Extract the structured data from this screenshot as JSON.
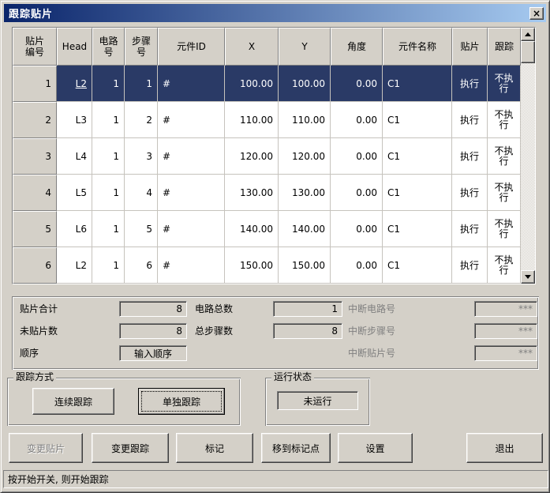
{
  "window": {
    "title": "跟踪贴片",
    "close_glyph": "×"
  },
  "table": {
    "headers": [
      "贴片\n编号",
      "Head",
      "电路\n号",
      "步骤\n号",
      "元件ID",
      "X",
      "Y",
      "角度",
      "元件名称",
      "贴片",
      "跟踪"
    ],
    "rows": [
      {
        "no": "1",
        "head": "L2",
        "circuit": "1",
        "step": "1",
        "component_id": "#",
        "x": "100.00",
        "y": "100.00",
        "angle": "0.00",
        "component_name": "C1",
        "place": "执行",
        "track": "不执\n行",
        "selected": true
      },
      {
        "no": "2",
        "head": "L3",
        "circuit": "1",
        "step": "2",
        "component_id": "#",
        "x": "110.00",
        "y": "110.00",
        "angle": "0.00",
        "component_name": "C1",
        "place": "执行",
        "track": "不执\n行",
        "selected": false
      },
      {
        "no": "3",
        "head": "L4",
        "circuit": "1",
        "step": "3",
        "component_id": "#",
        "x": "120.00",
        "y": "120.00",
        "angle": "0.00",
        "component_name": "C1",
        "place": "执行",
        "track": "不执\n行",
        "selected": false
      },
      {
        "no": "4",
        "head": "L5",
        "circuit": "1",
        "step": "4",
        "component_id": "#",
        "x": "130.00",
        "y": "130.00",
        "angle": "0.00",
        "component_name": "C1",
        "place": "执行",
        "track": "不执\n行",
        "selected": false
      },
      {
        "no": "5",
        "head": "L6",
        "circuit": "1",
        "step": "5",
        "component_id": "#",
        "x": "140.00",
        "y": "140.00",
        "angle": "0.00",
        "component_name": "C1",
        "place": "执行",
        "track": "不执\n行",
        "selected": false
      },
      {
        "no": "6",
        "head": "L2",
        "circuit": "1",
        "step": "6",
        "component_id": "#",
        "x": "150.00",
        "y": "150.00",
        "angle": "0.00",
        "component_name": "C1",
        "place": "执行",
        "track": "不执\n行",
        "selected": false
      }
    ]
  },
  "stats": {
    "total": {
      "label": "贴片合计",
      "value": "8"
    },
    "unplaced": {
      "label": "未贴片数",
      "value": "8"
    },
    "order": {
      "label": "顺序",
      "value": "输入顺序"
    },
    "circuits": {
      "label": "电路总数",
      "value": "1"
    },
    "steps": {
      "label": "总步骤数",
      "value": "8"
    },
    "int_circuit": {
      "label": "中断电路号",
      "value": "***"
    },
    "int_step": {
      "label": "中断步骤号",
      "value": "***"
    },
    "int_patch": {
      "label": "中断贴片号",
      "value": "***"
    }
  },
  "tracking_mode": {
    "title": "跟踪方式",
    "continuous_label": "连续跟踪",
    "single_label": "单独跟踪"
  },
  "run_status": {
    "title": "运行状态",
    "value": "未运行"
  },
  "buttons": {
    "change_patch": "变更贴片",
    "change_track": "变更跟踪",
    "mark": "标记",
    "move_to_mark": "移到标记点",
    "settings": "设置",
    "exit": "退出"
  },
  "status_bar": "按开始开关, 则开始跟踪",
  "colors": {
    "face": "#d4d0c8",
    "titlebar_start": "#0a246a",
    "titlebar_end": "#a6caf0",
    "highlight_row": "#2a3a66",
    "grid_line": "#c6c3bd",
    "disabled_text": "#808080"
  }
}
